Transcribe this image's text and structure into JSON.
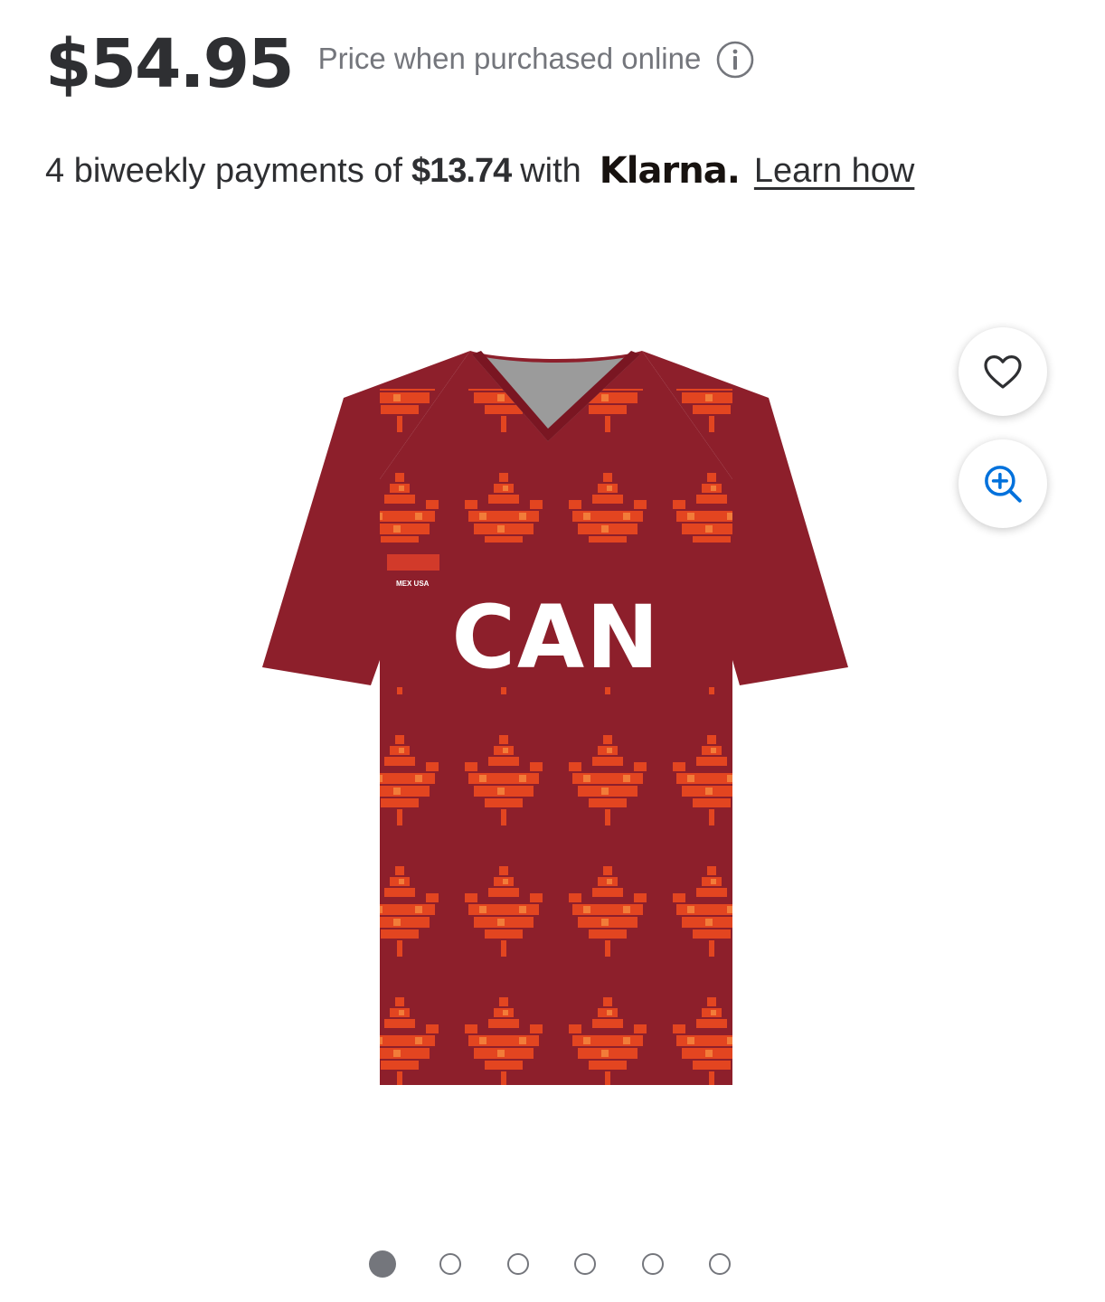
{
  "product": {
    "price": "$54.95",
    "price_note": "Price when purchased online",
    "info_icon": "info-icon",
    "jersey_text": "CAN",
    "jersey_badge_text": "MEX USA"
  },
  "klarna": {
    "prefix": "4 biweekly payments of",
    "amount": "$13.74",
    "with": "with",
    "logo": "Klarna.",
    "learn_link": "Learn how"
  },
  "actions": {
    "favorite_icon": "heart-icon",
    "zoom_icon": "zoom-in-icon"
  },
  "carousel": {
    "total": 6,
    "active_index": 0
  },
  "colors": {
    "jersey_base": "#8d1f2b",
    "jersey_leaf": "#e8471f",
    "link_blue": "#0071dc",
    "text": "#2e2f32",
    "muted": "#74767c"
  }
}
